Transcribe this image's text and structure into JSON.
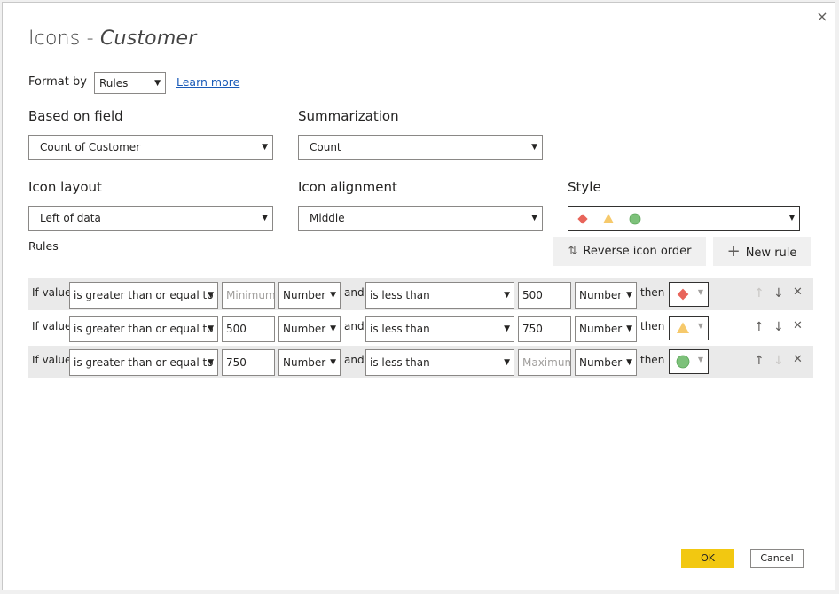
{
  "dialog": {
    "title": "Icons - ",
    "title_field": "Customer",
    "close_label": "×"
  },
  "format_by": {
    "label": "Format by",
    "value": "Rules",
    "learn_more": "Learn more"
  },
  "based_on_field": {
    "label": "Based on field",
    "value": "Count of Customer"
  },
  "summarization": {
    "label": "Summarization",
    "value": "Count"
  },
  "icon_layout": {
    "label": "Icon layout",
    "value": "Left of data"
  },
  "icon_alignment": {
    "label": "Icon alignment",
    "value": "Middle"
  },
  "style": {
    "label": "Style",
    "icons": [
      "red-diamond-icon",
      "yellow-triangle-icon",
      "green-circle-icon"
    ]
  },
  "rules": {
    "label": "Rules",
    "reverse_label": "Reverse icon order",
    "new_rule_label": "New rule",
    "items": [
      {
        "if_label": "If value",
        "condition1": "is greater than or equal to",
        "value1": "",
        "value1_placeholder": "Minimum",
        "type1": "Number",
        "and_label": "and",
        "condition2": "is less than",
        "value2": "500",
        "value2_placeholder": "",
        "type2": "Number",
        "then_label": "then",
        "icon": "red-diamond-icon"
      },
      {
        "if_label": "If value",
        "condition1": "is greater than or equal to",
        "value1": "500",
        "value1_placeholder": "",
        "type1": "Number",
        "and_label": "and",
        "condition2": "is less than",
        "value2": "750",
        "value2_placeholder": "",
        "type2": "Number",
        "then_label": "then",
        "icon": "yellow-triangle-icon"
      },
      {
        "if_label": "If value",
        "condition1": "is greater than or equal to",
        "value1": "750",
        "value1_placeholder": "",
        "type1": "Number",
        "and_label": "and",
        "condition2": "is less than",
        "value2": "",
        "value2_placeholder": "Maximum",
        "type2": "Number",
        "then_label": "then",
        "icon": "green-circle-icon"
      }
    ]
  },
  "footer": {
    "ok_label": "OK",
    "cancel_label": "Cancel"
  },
  "colors": {
    "accent": "#f2c811",
    "link": "#1a5bb8",
    "diamond": "#e8645a",
    "triangle": "#f6c96b",
    "circle": "#7dc17a"
  }
}
